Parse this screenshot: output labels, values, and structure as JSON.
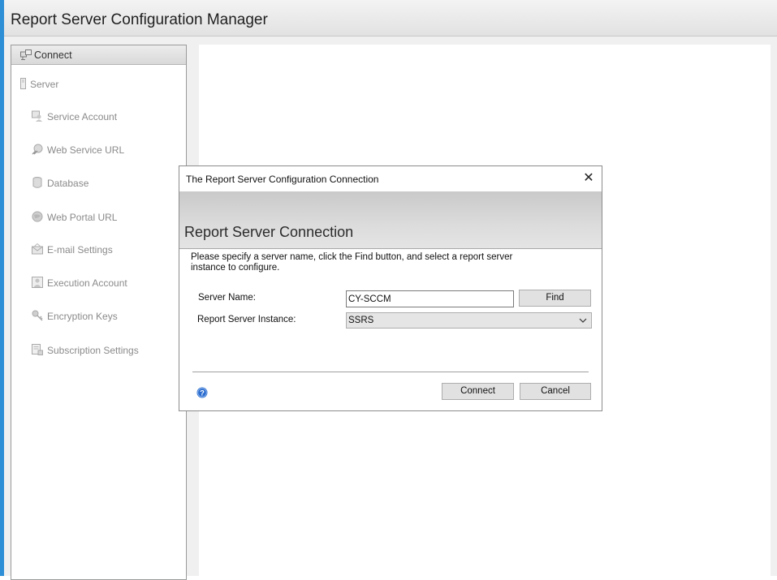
{
  "app": {
    "title": "Report Server Configuration Manager",
    "accent_color": "#2e8fd6"
  },
  "sidebar": {
    "connect_label": "Connect",
    "items": [
      {
        "label": "Server",
        "icon": "server-icon"
      },
      {
        "label": "Service Account",
        "icon": "service-account-icon"
      },
      {
        "label": "Web Service URL",
        "icon": "web-service-url-icon"
      },
      {
        "label": "Database",
        "icon": "database-icon"
      },
      {
        "label": "Web Portal URL",
        "icon": "web-portal-icon"
      },
      {
        "label": "E-mail Settings",
        "icon": "email-icon"
      },
      {
        "label": "Execution Account",
        "icon": "execution-account-icon"
      },
      {
        "label": "Encryption Keys",
        "icon": "key-icon"
      },
      {
        "label": "Subscription Settings",
        "icon": "subscription-icon"
      }
    ]
  },
  "dialog": {
    "title": "The Report Server Configuration Connection",
    "heading": "Report Server Connection",
    "instructions": "Please specify a server name, click the Find button, and select a report server instance to configure.",
    "server_name_label": "Server Name:",
    "server_name_value": "CY-SCCM",
    "find_label": "Find",
    "instance_label": "Report Server Instance:",
    "instance_value": "SSRS",
    "connect_label": "Connect",
    "cancel_label": "Cancel",
    "help_icon": "help-icon",
    "help_color": "#2a6ccf"
  }
}
